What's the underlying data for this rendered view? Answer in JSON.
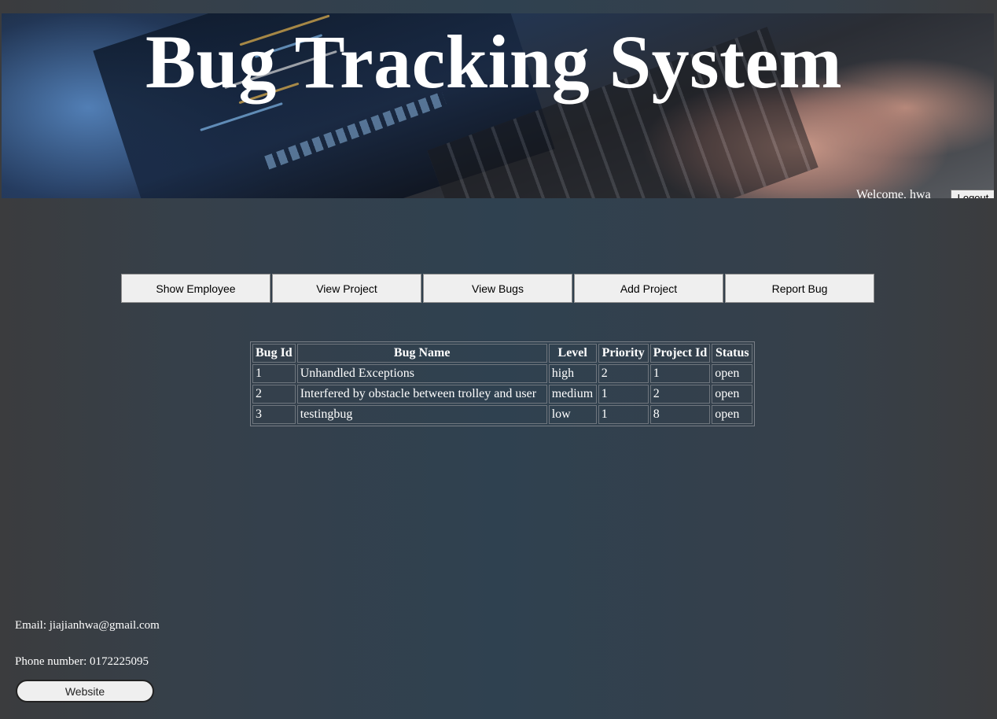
{
  "header": {
    "title": "Bug Tracking System",
    "welcome_text": "Welcome, hwa",
    "logout_label": "Logout"
  },
  "nav": {
    "items": [
      {
        "label": "Show Employee"
      },
      {
        "label": "View Project"
      },
      {
        "label": "View Bugs"
      },
      {
        "label": "Add Project"
      },
      {
        "label": "Report Bug"
      }
    ]
  },
  "bugs_table": {
    "columns": [
      "Bug Id",
      "Bug Name",
      "Level",
      "Priority",
      "Project Id",
      "Status"
    ],
    "rows": [
      [
        "1",
        "Unhandled Exceptions",
        "high",
        "2",
        "1",
        "open"
      ],
      [
        "2",
        "Interfered by obstacle between trolley and user",
        "medium",
        "1",
        "2",
        "open"
      ],
      [
        "3",
        "testingbug",
        "low",
        "1",
        "8",
        "open"
      ]
    ]
  },
  "footer": {
    "email_text": "Email: jiajianhwa@gmail.com",
    "phone_text": "Phone number: 0172225095",
    "website_label": "Website"
  },
  "colors": {
    "background": "#2f4150",
    "button_bg": "#efefef",
    "text": "#ffffff"
  }
}
